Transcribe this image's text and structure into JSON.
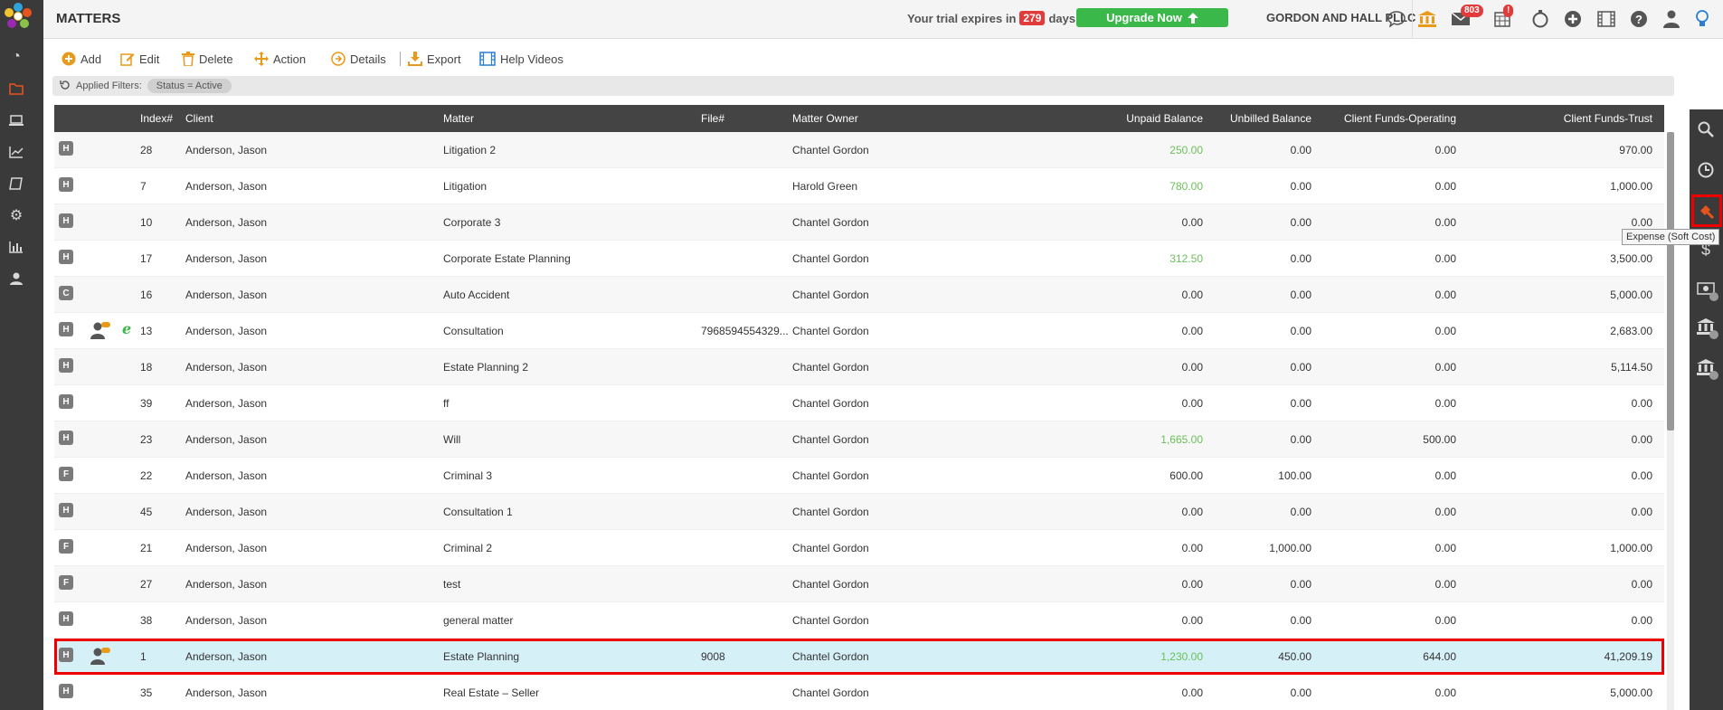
{
  "header": {
    "title": "MATTERS",
    "trial_prefix": "Your trial expires in",
    "trial_days": "279",
    "trial_suffix": "days.",
    "upgrade_label": "Upgrade Now",
    "firm_name": "GORDON AND HALL PLLC",
    "mail_badge": "803",
    "calendar_badge": "!"
  },
  "toolbar": {
    "add": "Add",
    "edit": "Edit",
    "delete": "Delete",
    "action": "Action",
    "details": "Details",
    "export": "Export",
    "help_videos": "Help Videos"
  },
  "filters": {
    "label": "Applied Filters:",
    "chip": "Status = Active"
  },
  "tooltip": "Expense (Soft Cost)",
  "columns": {
    "index": "Index#",
    "client": "Client",
    "matter": "Matter",
    "file": "File#",
    "owner": "Matter Owner",
    "unpaid": "Unpaid Balance",
    "unbilled": "Unbilled Balance",
    "operating": "Client Funds-Operating",
    "trust": "Client Funds-Trust"
  },
  "rows": [
    {
      "tag": "H",
      "index": "28",
      "client": "Anderson, Jason",
      "matter": "Litigation 2",
      "file": "",
      "owner": "Chantel Gordon",
      "unpaid": "250.00",
      "unpaid_green": true,
      "unbilled": "0.00",
      "operating": "0.00",
      "trust": "970.00"
    },
    {
      "tag": "H",
      "index": "7",
      "client": "Anderson, Jason",
      "matter": "Litigation",
      "file": "",
      "owner": "Harold Green",
      "unpaid": "780.00",
      "unpaid_green": true,
      "unbilled": "0.00",
      "operating": "0.00",
      "trust": "1,000.00"
    },
    {
      "tag": "H",
      "index": "10",
      "client": "Anderson, Jason",
      "matter": "Corporate 3",
      "file": "",
      "owner": "Chantel Gordon",
      "unpaid": "0.00",
      "unpaid_green": false,
      "unbilled": "0.00",
      "operating": "0.00",
      "trust": "0.00"
    },
    {
      "tag": "H",
      "index": "17",
      "client": "Anderson, Jason",
      "matter": "Corporate Estate Planning",
      "file": "",
      "owner": "Chantel Gordon",
      "unpaid": "312.50",
      "unpaid_green": true,
      "unbilled": "0.00",
      "operating": "0.00",
      "trust": "3,500.00"
    },
    {
      "tag": "C",
      "index": "16",
      "client": "Anderson, Jason",
      "matter": "Auto Accident",
      "file": "",
      "owner": "Chantel Gordon",
      "unpaid": "0.00",
      "unpaid_green": false,
      "unbilled": "0.00",
      "operating": "0.00",
      "trust": "5,000.00"
    },
    {
      "tag": "H",
      "index": "13",
      "client": "Anderson, Jason",
      "matter": "Consultation",
      "file": "7968594554329...",
      "owner": "Chantel Gordon",
      "unpaid": "0.00",
      "unpaid_green": false,
      "unbilled": "0.00",
      "operating": "0.00",
      "trust": "2,683.00",
      "person": true,
      "e": true
    },
    {
      "tag": "H",
      "index": "18",
      "client": "Anderson, Jason",
      "matter": "Estate Planning 2",
      "file": "",
      "owner": "Chantel Gordon",
      "unpaid": "0.00",
      "unpaid_green": false,
      "unbilled": "0.00",
      "operating": "0.00",
      "trust": "5,114.50"
    },
    {
      "tag": "H",
      "index": "39",
      "client": "Anderson, Jason",
      "matter": "ff",
      "file": "",
      "owner": "Chantel Gordon",
      "unpaid": "0.00",
      "unpaid_green": false,
      "unbilled": "0.00",
      "operating": "0.00",
      "trust": "0.00"
    },
    {
      "tag": "H",
      "index": "23",
      "client": "Anderson, Jason",
      "matter": "Will",
      "file": "",
      "owner": "Chantel Gordon",
      "unpaid": "1,665.00",
      "unpaid_green": true,
      "unbilled": "0.00",
      "operating": "500.00",
      "trust": "0.00"
    },
    {
      "tag": "F",
      "index": "22",
      "client": "Anderson, Jason",
      "matter": "Criminal 3",
      "file": "",
      "owner": "Chantel Gordon",
      "unpaid": "600.00",
      "unpaid_green": false,
      "unbilled": "100.00",
      "operating": "0.00",
      "trust": "0.00"
    },
    {
      "tag": "H",
      "index": "45",
      "client": "Anderson, Jason",
      "matter": "Consultation 1",
      "file": "",
      "owner": "Chantel Gordon",
      "unpaid": "0.00",
      "unpaid_green": false,
      "unbilled": "0.00",
      "operating": "0.00",
      "trust": "0.00"
    },
    {
      "tag": "F",
      "index": "21",
      "client": "Anderson, Jason",
      "matter": "Criminal 2",
      "file": "",
      "owner": "Chantel Gordon",
      "unpaid": "0.00",
      "unpaid_green": false,
      "unbilled": "1,000.00",
      "operating": "0.00",
      "trust": "1,000.00"
    },
    {
      "tag": "F",
      "index": "27",
      "client": "Anderson, Jason",
      "matter": "test",
      "file": "",
      "owner": "Chantel Gordon",
      "unpaid": "0.00",
      "unpaid_green": false,
      "unbilled": "0.00",
      "operating": "0.00",
      "trust": "0.00"
    },
    {
      "tag": "H",
      "index": "38",
      "client": "Anderson, Jason",
      "matter": "general matter",
      "file": "",
      "owner": "Chantel Gordon",
      "unpaid": "0.00",
      "unpaid_green": false,
      "unbilled": "0.00",
      "operating": "0.00",
      "trust": "0.00"
    },
    {
      "tag": "H",
      "index": "1",
      "client": "Anderson, Jason",
      "matter": "Estate Planning",
      "file": "9008",
      "owner": "Chantel Gordon",
      "unpaid": "1,230.00",
      "unpaid_green": true,
      "unbilled": "450.00",
      "operating": "644.00",
      "trust": "41,209.19",
      "person": true,
      "selected": true
    },
    {
      "tag": "H",
      "index": "35",
      "client": "Anderson, Jason",
      "matter": "Real Estate – Seller",
      "file": "",
      "owner": "Chantel Gordon",
      "unpaid": "0.00",
      "unpaid_green": false,
      "unbilled": "0.00",
      "operating": "0.00",
      "trust": "5,000.00"
    }
  ]
}
